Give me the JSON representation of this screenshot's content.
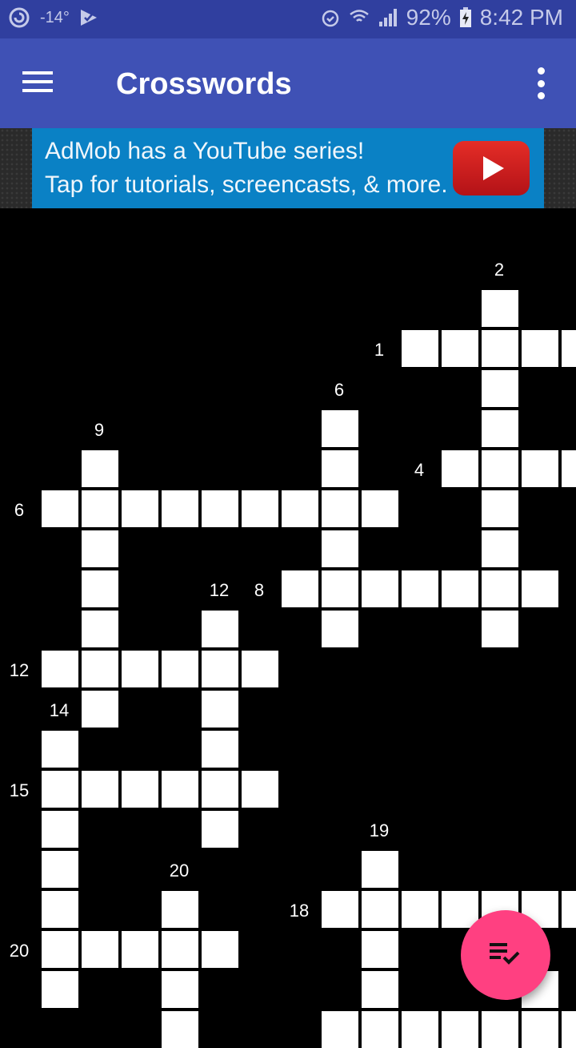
{
  "status_bar": {
    "temperature": "-14°",
    "battery": "92%",
    "time": "8:42 PM",
    "icons_left": [
      "sync-icon",
      "temperature",
      "play-store-check-icon"
    ],
    "icons_right": [
      "alarm-icon",
      "wifi-icon",
      "signal-icon",
      "battery-charging-icon"
    ]
  },
  "app_bar": {
    "title": "Crosswords",
    "menu_icon": "hamburger-menu-icon",
    "overflow_icon": "more-vert-icon",
    "color": "#3f51b5"
  },
  "ad_banner": {
    "line1": "AdMob has a YouTube series!",
    "line2": "Tap for tutorials, screencasts, & more.",
    "icon": "youtube-play-icon",
    "color": "#0a81c5"
  },
  "crossword": {
    "white_cells": [
      [
        0,
        11
      ],
      [
        1,
        9
      ],
      [
        1,
        10
      ],
      [
        1,
        11
      ],
      [
        1,
        12
      ],
      [
        1,
        13
      ],
      [
        2,
        11
      ],
      [
        3,
        7
      ],
      [
        3,
        11
      ],
      [
        4,
        1
      ],
      [
        4,
        7
      ],
      [
        4,
        10
      ],
      [
        4,
        11
      ],
      [
        4,
        12
      ],
      [
        4,
        13
      ],
      [
        5,
        0
      ],
      [
        5,
        1
      ],
      [
        5,
        2
      ],
      [
        5,
        3
      ],
      [
        5,
        4
      ],
      [
        5,
        5
      ],
      [
        5,
        6
      ],
      [
        5,
        7
      ],
      [
        5,
        8
      ],
      [
        5,
        11
      ],
      [
        6,
        1
      ],
      [
        6,
        7
      ],
      [
        6,
        11
      ],
      [
        7,
        1
      ],
      [
        7,
        6
      ],
      [
        7,
        7
      ],
      [
        7,
        8
      ],
      [
        7,
        9
      ],
      [
        7,
        10
      ],
      [
        7,
        11
      ],
      [
        7,
        12
      ],
      [
        8,
        1
      ],
      [
        8,
        4
      ],
      [
        8,
        7
      ],
      [
        8,
        11
      ],
      [
        9,
        0
      ],
      [
        9,
        1
      ],
      [
        9,
        2
      ],
      [
        9,
        3
      ],
      [
        9,
        4
      ],
      [
        9,
        5
      ],
      [
        10,
        1
      ],
      [
        10,
        4
      ],
      [
        11,
        0
      ],
      [
        11,
        4
      ],
      [
        12,
        0
      ],
      [
        12,
        1
      ],
      [
        12,
        2
      ],
      [
        12,
        3
      ],
      [
        12,
        4
      ],
      [
        12,
        5
      ],
      [
        13,
        0
      ],
      [
        13,
        4
      ],
      [
        14,
        0
      ],
      [
        14,
        8
      ],
      [
        15,
        0
      ],
      [
        15,
        3
      ],
      [
        15,
        7
      ],
      [
        15,
        8
      ],
      [
        15,
        9
      ],
      [
        15,
        10
      ],
      [
        15,
        11
      ],
      [
        15,
        12
      ],
      [
        15,
        13
      ],
      [
        16,
        0
      ],
      [
        16,
        1
      ],
      [
        16,
        2
      ],
      [
        16,
        3
      ],
      [
        16,
        4
      ],
      [
        16,
        8
      ],
      [
        17,
        0
      ],
      [
        17,
        3
      ],
      [
        17,
        8
      ],
      [
        17,
        12
      ],
      [
        18,
        3
      ],
      [
        18,
        7
      ],
      [
        18,
        8
      ],
      [
        18,
        9
      ],
      [
        18,
        10
      ],
      [
        18,
        11
      ],
      [
        18,
        12
      ],
      [
        18,
        13
      ]
    ],
    "clue_numbers": [
      {
        "label": "2",
        "row": -1,
        "col": 11
      },
      {
        "label": "1",
        "row": 1,
        "col": 8
      },
      {
        "label": "6",
        "row": 2,
        "col": 7
      },
      {
        "label": "9",
        "row": 3,
        "col": 1
      },
      {
        "label": "4",
        "row": 4,
        "col": 9
      },
      {
        "label": "6",
        "row": 5,
        "col": -1
      },
      {
        "label": "12",
        "row": 7,
        "col": 4
      },
      {
        "label": "8",
        "row": 7,
        "col": 5
      },
      {
        "label": "12",
        "row": 9,
        "col": -1
      },
      {
        "label": "14",
        "row": 10,
        "col": 0
      },
      {
        "label": "15",
        "row": 12,
        "col": -1
      },
      {
        "label": "19",
        "row": 13,
        "col": 8
      },
      {
        "label": "20",
        "row": 14,
        "col": 3
      },
      {
        "label": "18",
        "row": 15,
        "col": 6
      },
      {
        "label": "20",
        "row": 16,
        "col": -1
      }
    ]
  },
  "fab": {
    "icon": "playlist-check-icon",
    "color": "#ff4081"
  }
}
